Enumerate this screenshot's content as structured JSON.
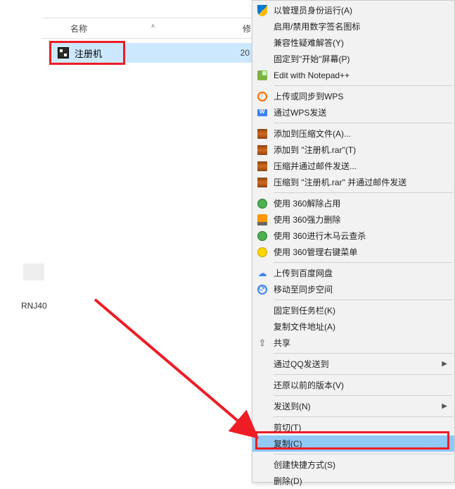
{
  "columns": {
    "name": "名称",
    "modified_prefix": "修"
  },
  "file": {
    "name": "注册机",
    "date_prefix": "20"
  },
  "footer": "RNJ40",
  "menu": {
    "admin": "以管理员身份运行(A)",
    "enable_sig": "启用/禁用数字签名图标",
    "compat": "兼容性疑难解答(Y)",
    "pin_start": "固定到\"开始\"屏幕(P)",
    "notepad": "Edit with Notepad++",
    "wps_upload": "上传或同步到WPS",
    "wps_send": "通过WPS发送",
    "rar_add": "添加到压缩文件(A)...",
    "rar_add_name": "添加到 \"注册机.rar\"(T)",
    "rar_email": "压缩并通过邮件发送...",
    "rar_email_name": "压缩到 \"注册机.rar\" 并通过邮件发送",
    "s360_release": "使用 360解除占用",
    "s360_delete": "使用 360强力删除",
    "s360_scan": "使用 360进行木马云查杀",
    "s360_menu": "使用 360管理右键菜单",
    "baidu_upload": "上传到百度网盘",
    "sync_space": "移动至同步空间",
    "pin_taskbar": "固定到任务栏(K)",
    "copy_path": "复制文件地址(A)",
    "share": "共享",
    "qq_send": "通过QQ发送到",
    "restore": "还原以前的版本(V)",
    "send_to": "发送到(N)",
    "cut": "剪切(T)",
    "copy": "复制(C)",
    "shortcut": "创建快捷方式(S)",
    "delete": "删除(D)"
  }
}
